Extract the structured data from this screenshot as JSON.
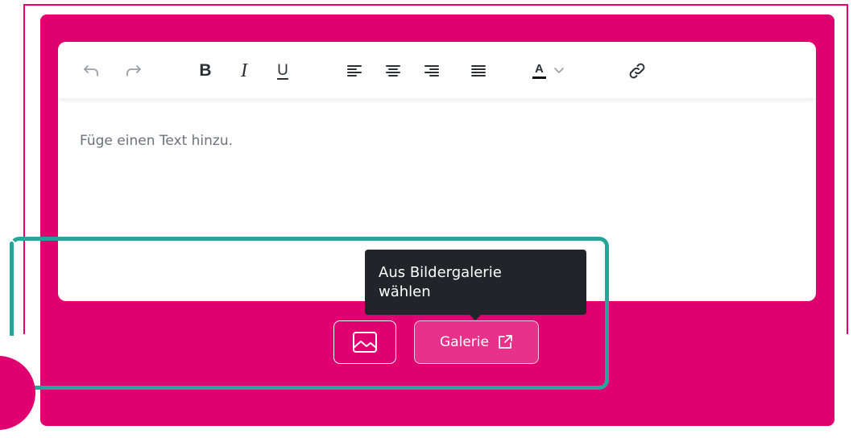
{
  "editor": {
    "placeholder_text": "Füge einen Text hinzu.",
    "toolbar": {
      "undo_icon": "undo-icon",
      "redo_icon": "redo-icon",
      "bold_label": "B",
      "italic_label": "I",
      "underline_label": "U",
      "align_left_icon": "align-left-icon",
      "align_center_icon": "align-center-icon",
      "align_right_icon": "align-right-icon",
      "align_justify_icon": "align-justify-icon",
      "text_color_label": "A",
      "text_color_dropdown_icon": "chevron-down-icon",
      "link_icon": "link-icon"
    }
  },
  "actions": {
    "image_button_icon": "image-icon",
    "gallery_button_label": "Galerie",
    "gallery_button_icon": "external-link-icon"
  },
  "tooltip": {
    "text_line1": "Aus Bildergalerie",
    "text_line2": "wählen"
  },
  "colors": {
    "panel": "#e0006f",
    "gallery_button": "#e8318a",
    "highlight": "#26a69a",
    "tooltip": "#212529"
  }
}
